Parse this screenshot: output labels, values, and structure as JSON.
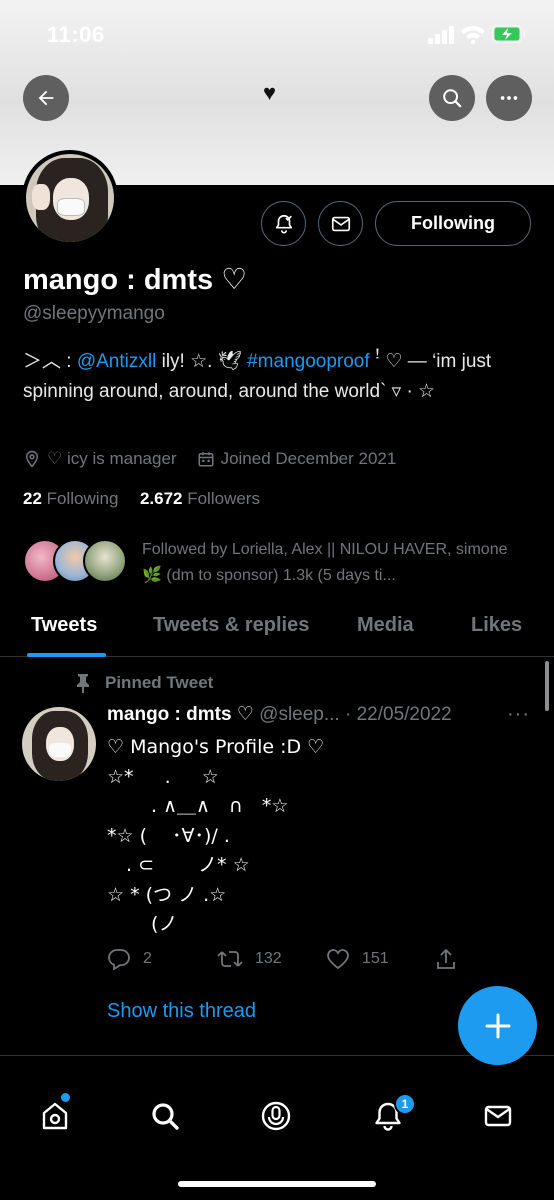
{
  "status_bar": {
    "time": "11:06"
  },
  "banner": {
    "heart": "♥"
  },
  "profile": {
    "display_name": "mango : dmts ♡",
    "handle": "@sleepyymango",
    "bio_prefix": "＞︿ : ",
    "bio_mention": "@Antizxll",
    "bio_mid": " ily! ☆. 🕊 ",
    "bio_hashtag": "#mangooproof",
    "bio_suffix": " ꜝ ♡ — ‘im just spinning around, around, around the world` ▿ · ☆",
    "location": "♡ icy is manager",
    "joined": "Joined December 2021",
    "following_count": "22",
    "following_label": "Following",
    "followers_count": "2.672",
    "followers_label": "Followers",
    "followed_by": "Followed by Loriella, Alex || NILOU HAVER, simone 🌿 (dm to sponsor) 1.3k (5 days ti...",
    "follow_button": "Following"
  },
  "tabs": [
    {
      "label": "Tweets",
      "active": true
    },
    {
      "label": "Tweets & replies",
      "active": false
    },
    {
      "label": "Media",
      "active": false
    },
    {
      "label": "Likes",
      "active": false
    }
  ],
  "tweet": {
    "pinned_label": "Pinned Tweet",
    "author_name": "mango : dmts ♡",
    "author_handle_date": " @sleep... · 22/05/2022",
    "text": "♡ Mango's Profile :D ♡\n☆*  　.  　☆\n 　　. ∧＿∧　∩　*☆\n*☆ ( 　･∀･)/ .\n　. ⊂　　 ノ* ☆\n☆ * (つ ノ .☆\n　　 (ノ",
    "replies": "2",
    "retweets": "132",
    "likes": "151",
    "show_thread": "Show this thread"
  },
  "nav": {
    "notifications_badge": "1"
  },
  "colors": {
    "accent": "#1d9bf0",
    "background": "#000000",
    "muted": "#71767b"
  }
}
